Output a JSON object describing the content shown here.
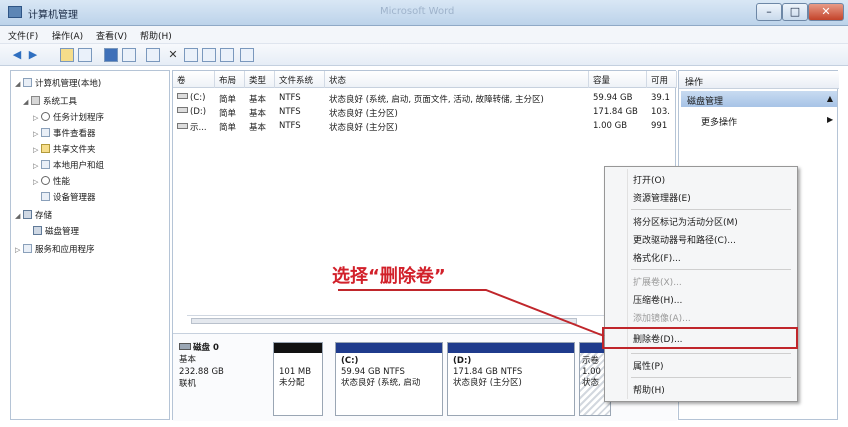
{
  "window": {
    "title": "计算机管理",
    "ghost_title": "Microsoft Word",
    "min_label": "–",
    "max_label": "□",
    "close_label": "✕"
  },
  "menu": [
    "文件(F)",
    "操作(A)",
    "查看(V)",
    "帮助(H)"
  ],
  "tree": {
    "root": "计算机管理(本地)",
    "system_tools": "系统工具",
    "task_scheduler": "任务计划程序",
    "event_viewer": "事件查看器",
    "shared_folders": "共享文件夹",
    "local_users": "本地用户和组",
    "performance": "性能",
    "device_manager": "设备管理器",
    "storage": "存储",
    "disk_management": "磁盘管理",
    "services_apps": "服务和应用程序"
  },
  "columns": [
    "卷",
    "布局",
    "类型",
    "文件系统",
    "状态",
    "容量",
    "可用"
  ],
  "rows": [
    {
      "vol": "(C:)",
      "layout": "简单",
      "type": "基本",
      "fs": "NTFS",
      "status": "状态良好 (系统, 启动, 页面文件, 活动, 故障转储, 主分区)",
      "capacity": "59.94 GB",
      "free": "39.1"
    },
    {
      "vol": "(D:)",
      "layout": "简单",
      "type": "基本",
      "fs": "NTFS",
      "status": "状态良好 (主分区)",
      "capacity": "171.84 GB",
      "free": "103."
    },
    {
      "vol": "示...",
      "layout": "简单",
      "type": "基本",
      "fs": "NTFS",
      "status": "状态良好 (主分区)",
      "capacity": "1.00 GB",
      "free": "991"
    }
  ],
  "disk": {
    "name": "磁盘 0",
    "type": "基本",
    "size": "232.88 GB",
    "state": "联机",
    "parts": [
      {
        "line1": "",
        "line2": "101 MB",
        "line3": "未分配"
      },
      {
        "line1": "(C:)",
        "line2": "59.94 GB NTFS",
        "line3": "状态良好 (系统, 启动"
      },
      {
        "line1": "(D:)",
        "line2": "171.84 GB NTFS",
        "line3": "状态良好 (主分区)"
      },
      {
        "line1": "示卷",
        "line2": "1.00",
        "line3": "状态"
      }
    ]
  },
  "actions": {
    "title": "操作",
    "section": "磁盘管理",
    "more": "更多操作",
    "section_arrow": "▲",
    "more_arrow": "▶"
  },
  "context_menu": {
    "open": "打开(O)",
    "explore": "资源管理器(E)",
    "mark_active": "将分区标记为活动分区(M)",
    "change_letter": "更改驱动器号和路径(C)...",
    "format": "格式化(F)...",
    "extend": "扩展卷(X)...",
    "shrink": "压缩卷(H)...",
    "add_mirror": "添加镜像(A)...",
    "delete": "删除卷(D)...",
    "properties": "属性(P)",
    "help": "帮助(H)"
  },
  "annotation": {
    "text": "选择“删除卷”",
    "color": "#d2202a"
  }
}
